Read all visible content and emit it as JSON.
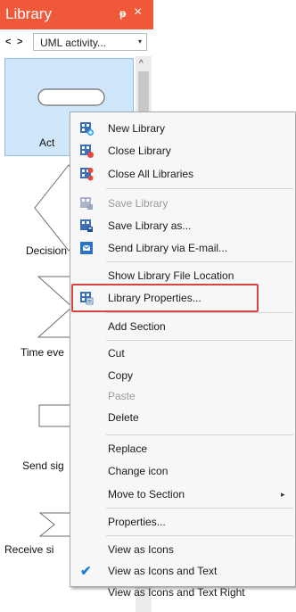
{
  "panel": {
    "title": "Library",
    "pin_symbol": "ᵽ",
    "close_symbol": "×",
    "nav_back": "<",
    "nav_forward": ">",
    "library_select": "UML activity...",
    "select_caret": "▾",
    "scroll_up": "^"
  },
  "items": [
    {
      "label": "Act"
    },
    {
      "label": "Decision"
    },
    {
      "label": "Time eve"
    },
    {
      "label": "Send sig"
    },
    {
      "label": "Receive si"
    }
  ],
  "menu": {
    "items": [
      {
        "label": "New Library",
        "icon": "new-library-icon",
        "disabled": false
      },
      {
        "label": "Close Library",
        "icon": "close-library-icon",
        "disabled": false
      },
      {
        "label": "Close All Libraries",
        "icon": "close-all-libraries-icon",
        "disabled": false
      },
      {
        "label": "Save Library",
        "icon": "save-library-icon",
        "disabled": true
      },
      {
        "label": "Save Library as...",
        "icon": "save-library-as-icon",
        "disabled": false
      },
      {
        "label": "Send Library via E-mail...",
        "icon": "send-library-icon",
        "disabled": false
      },
      {
        "label": "Show Library File Location",
        "icon": "",
        "disabled": false
      },
      {
        "label": "Library Properties...",
        "icon": "library-properties-icon",
        "disabled": false
      },
      {
        "label": "Add Section",
        "icon": "",
        "disabled": false
      },
      {
        "label": "Cut",
        "icon": "",
        "disabled": false
      },
      {
        "label": "Copy",
        "icon": "",
        "disabled": false
      },
      {
        "label": "Paste",
        "icon": "",
        "disabled": true
      },
      {
        "label": "Delete",
        "icon": "",
        "disabled": false
      },
      {
        "label": "Replace",
        "icon": "",
        "disabled": false
      },
      {
        "label": "Change icon",
        "icon": "",
        "disabled": false
      },
      {
        "label": "Move to Section",
        "icon": "",
        "disabled": false,
        "submenu_arrow": "▸"
      },
      {
        "label": "Properties...",
        "icon": "",
        "disabled": false
      },
      {
        "label": "View as Icons",
        "icon": "",
        "disabled": false
      },
      {
        "label": "View as Icons and Text",
        "icon": "",
        "disabled": false,
        "checked": true,
        "check_mark": "✔"
      },
      {
        "label": "View as Icons and Text Right",
        "icon": "",
        "disabled": false
      }
    ]
  },
  "colors": {
    "header": "#f0583a",
    "highlight_border": "#d64541",
    "check": "#1f7fd6"
  }
}
